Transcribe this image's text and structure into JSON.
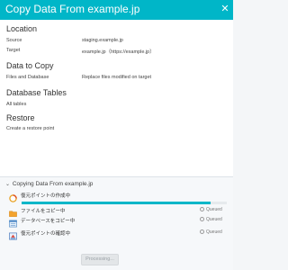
{
  "dialog": {
    "title": "Copy Data From example.jp",
    "close_icon": "close-icon"
  },
  "location": {
    "heading": "Location",
    "source_label": "Source",
    "source_value": "staging.example.jp",
    "target_label": "Target",
    "target_value": "example.jp（https://example.jp）"
  },
  "data_to_copy": {
    "heading": "Data to Copy",
    "label": "Files and Database",
    "value": "Replace files modified on target"
  },
  "database_tables": {
    "heading": "Database Tables",
    "value": "All tables"
  },
  "restore": {
    "heading": "Restore",
    "value": "Create a restore point"
  },
  "progress": {
    "heading": "Copying Data From example.jp",
    "current_progress": 0.92,
    "accent_color": "#00b6c8",
    "tasks": [
      {
        "label": "復元ポイントの作成中",
        "status": "",
        "icon": "spinner-icon"
      },
      {
        "label": "ファイルをコピー中",
        "status": "Queued",
        "icon": "folder-icon"
      },
      {
        "label": "データベースをコピー中",
        "status": "Queued",
        "icon": "database-icon"
      },
      {
        "label": "復元ポイントの確認中",
        "status": "Queued",
        "icon": "restore-point-icon"
      }
    ]
  },
  "footer": {
    "processing_label": "Processing..."
  }
}
